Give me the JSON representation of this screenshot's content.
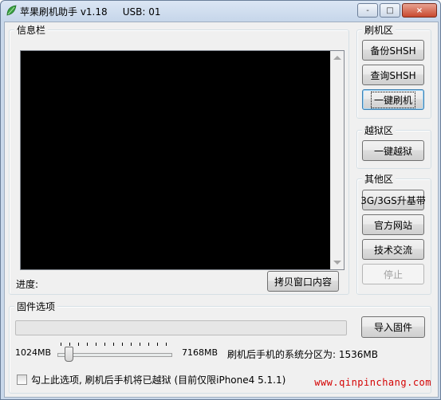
{
  "window": {
    "title": "苹果刷机助手 v1.18     USB: 01",
    "minimize": "-",
    "maximize": "□",
    "close": "×"
  },
  "info": {
    "group_label": "信息栏",
    "progress_label": "进度:",
    "copy_button": "拷贝窗口内容"
  },
  "flash": {
    "group_label": "刷机区",
    "backup_shsh": "备份SHSH",
    "query_shsh": "查询SHSH",
    "one_click_flash": "一键刷机"
  },
  "jailbreak": {
    "group_label": "越狱区",
    "one_click_jailbreak": "一键越狱"
  },
  "other": {
    "group_label": "其他区",
    "baseband_upgrade": "3G/3GS升基带",
    "official_site": "官方网站",
    "tech_exchange": "技术交流",
    "stop": "停止"
  },
  "firmware": {
    "group_label": "固件选项",
    "import_button": "导入固件",
    "slider_min": "1024MB",
    "slider_max": "7168MB",
    "partition_text": "刷机后手机的系统分区为: 1536MB",
    "slider_value_mb": 1536,
    "jailbreak_option": "勾上此选项, 刷机后手机将已越狱 (目前仅限iPhone4 5.1.1)",
    "jailbreak_checked": false
  },
  "watermark": "www.qinpinchang.com"
}
